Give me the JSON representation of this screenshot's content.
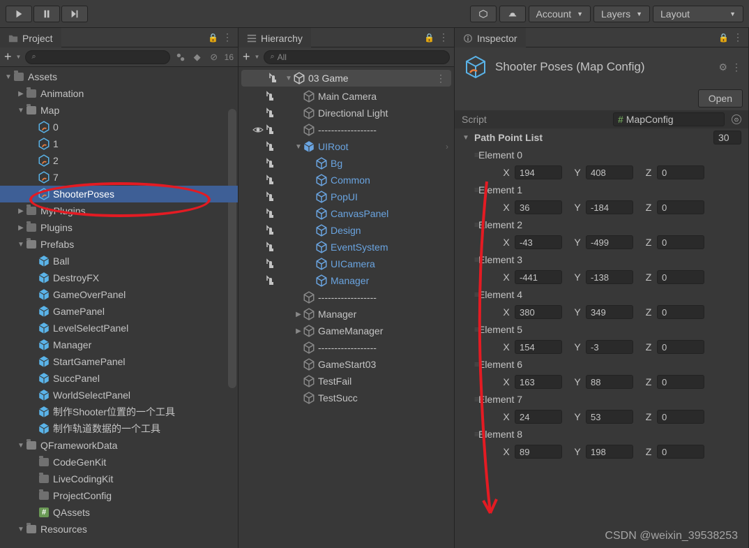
{
  "toolbar": {
    "account": "Account",
    "layers": "Layers",
    "layout": "Layout"
  },
  "panels": {
    "project": {
      "title": "Project",
      "hiddenCount": "16"
    },
    "hierarchy": {
      "title": "Hierarchy",
      "searchPlaceholder": "All"
    },
    "inspector": {
      "title": "Inspector"
    }
  },
  "project_tree": [
    {
      "label": "Assets",
      "depth": 0,
      "fold": "open",
      "icon": "folder"
    },
    {
      "label": "Animation",
      "depth": 1,
      "fold": "closed",
      "icon": "folder"
    },
    {
      "label": "Map",
      "depth": 1,
      "fold": "open",
      "icon": "folder-open"
    },
    {
      "label": "0",
      "depth": 2,
      "fold": "none",
      "icon": "asset"
    },
    {
      "label": "1",
      "depth": 2,
      "fold": "none",
      "icon": "asset"
    },
    {
      "label": "2",
      "depth": 2,
      "fold": "none",
      "icon": "asset"
    },
    {
      "label": "7",
      "depth": 2,
      "fold": "none",
      "icon": "asset"
    },
    {
      "label": "ShooterPoses",
      "depth": 2,
      "fold": "none",
      "icon": "asset",
      "selected": true
    },
    {
      "label": "MyPlugins",
      "depth": 1,
      "fold": "closed",
      "icon": "folder"
    },
    {
      "label": "Plugins",
      "depth": 1,
      "fold": "closed",
      "icon": "folder"
    },
    {
      "label": "Prefabs",
      "depth": 1,
      "fold": "open",
      "icon": "folder-open"
    },
    {
      "label": "Ball",
      "depth": 2,
      "fold": "none",
      "icon": "prefab"
    },
    {
      "label": "DestroyFX",
      "depth": 2,
      "fold": "none",
      "icon": "prefab"
    },
    {
      "label": "GameOverPanel",
      "depth": 2,
      "fold": "none",
      "icon": "prefab"
    },
    {
      "label": "GamePanel",
      "depth": 2,
      "fold": "none",
      "icon": "prefab"
    },
    {
      "label": "LevelSelectPanel",
      "depth": 2,
      "fold": "none",
      "icon": "prefab"
    },
    {
      "label": "Manager",
      "depth": 2,
      "fold": "none",
      "icon": "prefab"
    },
    {
      "label": "StartGamePanel",
      "depth": 2,
      "fold": "none",
      "icon": "prefab"
    },
    {
      "label": "SuccPanel",
      "depth": 2,
      "fold": "none",
      "icon": "prefab"
    },
    {
      "label": "WorldSelectPanel",
      "depth": 2,
      "fold": "none",
      "icon": "prefab"
    },
    {
      "label": "制作Shooter位置的一个工具",
      "depth": 2,
      "fold": "none",
      "icon": "prefab"
    },
    {
      "label": "制作轨道数据的一个工具",
      "depth": 2,
      "fold": "none",
      "icon": "prefab"
    },
    {
      "label": "QFrameworkData",
      "depth": 1,
      "fold": "open",
      "icon": "folder-open"
    },
    {
      "label": "CodeGenKit",
      "depth": 2,
      "fold": "none",
      "icon": "folder"
    },
    {
      "label": "LiveCodingKit",
      "depth": 2,
      "fold": "none",
      "icon": "folder"
    },
    {
      "label": "ProjectConfig",
      "depth": 2,
      "fold": "none",
      "icon": "folder"
    },
    {
      "label": "QAssets",
      "depth": 2,
      "fold": "none",
      "icon": "hash"
    },
    {
      "label": "Resources",
      "depth": 1,
      "fold": "open",
      "icon": "folder-open"
    }
  ],
  "hierarchy_tree": [
    {
      "label": "03 Game",
      "depth": 0,
      "fold": "open",
      "icon": "scene",
      "scene": true
    },
    {
      "label": "Main Camera",
      "depth": 1,
      "fold": "none",
      "icon": "go",
      "dim": true
    },
    {
      "label": "Directional Light",
      "depth": 1,
      "fold": "none",
      "icon": "go",
      "dim": true
    },
    {
      "label": "------------------",
      "depth": 1,
      "fold": "none",
      "icon": "go",
      "dim": true,
      "eye": true
    },
    {
      "label": "UIRoot",
      "depth": 1,
      "fold": "open",
      "icon": "prefab",
      "blue": true,
      "chevron": true,
      "dim": true
    },
    {
      "label": "Bg",
      "depth": 2,
      "fold": "none",
      "icon": "go",
      "blue": true,
      "dim": true
    },
    {
      "label": "Common",
      "depth": 2,
      "fold": "none",
      "icon": "go",
      "blue": true,
      "dim": true
    },
    {
      "label": "PopUI",
      "depth": 2,
      "fold": "none",
      "icon": "go",
      "blue": true,
      "dim": true
    },
    {
      "label": "CanvasPanel",
      "depth": 2,
      "fold": "none",
      "icon": "go",
      "blue": true,
      "dim": true
    },
    {
      "label": "Design",
      "depth": 2,
      "fold": "none",
      "icon": "go",
      "blue": true,
      "dim": true
    },
    {
      "label": "EventSystem",
      "depth": 2,
      "fold": "none",
      "icon": "go",
      "blue": true,
      "dim": true
    },
    {
      "label": "UICamera",
      "depth": 2,
      "fold": "none",
      "icon": "go",
      "blue": true,
      "dim": true
    },
    {
      "label": "Manager",
      "depth": 2,
      "fold": "none",
      "icon": "go",
      "blue": true,
      "dim": true
    },
    {
      "label": "------------------",
      "depth": 1,
      "fold": "none",
      "icon": "go"
    },
    {
      "label": "Manager",
      "depth": 1,
      "fold": "closed",
      "icon": "go"
    },
    {
      "label": "GameManager",
      "depth": 1,
      "fold": "closed",
      "icon": "go"
    },
    {
      "label": "------------------",
      "depth": 1,
      "fold": "none",
      "icon": "go"
    },
    {
      "label": "GameStart03",
      "depth": 1,
      "fold": "none",
      "icon": "go"
    },
    {
      "label": "TestFail",
      "depth": 1,
      "fold": "none",
      "icon": "go"
    },
    {
      "label": "TestSucc",
      "depth": 1,
      "fold": "none",
      "icon": "go"
    }
  ],
  "inspector": {
    "title": "Shooter Poses (Map Config)",
    "open_label": "Open",
    "script_label": "Script",
    "script_value": "MapConfig",
    "list_label": "Path Point List",
    "list_count": "30",
    "elements": [
      {
        "name": "Element 0",
        "x": "194",
        "y": "408",
        "z": "0"
      },
      {
        "name": "Element 1",
        "x": "36",
        "y": "-184",
        "z": "0"
      },
      {
        "name": "Element 2",
        "x": "-43",
        "y": "-499",
        "z": "0"
      },
      {
        "name": "Element 3",
        "x": "-441",
        "y": "-138",
        "z": "0"
      },
      {
        "name": "Element 4",
        "x": "380",
        "y": "349",
        "z": "0"
      },
      {
        "name": "Element 5",
        "x": "154",
        "y": "-3",
        "z": "0"
      },
      {
        "name": "Element 6",
        "x": "163",
        "y": "88",
        "z": "0"
      },
      {
        "name": "Element 7",
        "x": "24",
        "y": "53",
        "z": "0"
      },
      {
        "name": "Element 8",
        "x": "89",
        "y": "198",
        "z": "0"
      }
    ]
  },
  "watermark": "CSDN @weixin_39538253"
}
